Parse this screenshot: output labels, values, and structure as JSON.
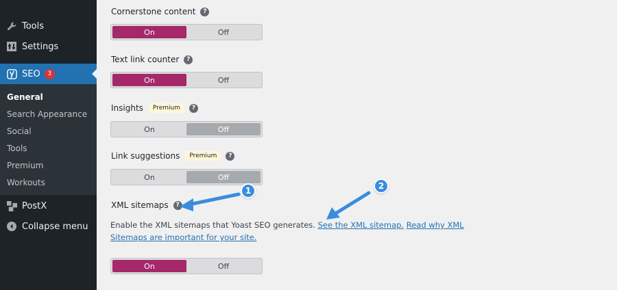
{
  "sidebar": {
    "items": [
      {
        "label": "Tools",
        "icon": "wrench-icon"
      },
      {
        "label": "Settings",
        "icon": "settings-icon"
      },
      {
        "label": "SEO",
        "icon": "yoast-icon",
        "badge": "3"
      },
      {
        "label": "PostX",
        "icon": "postx-icon"
      },
      {
        "label": "Collapse menu",
        "icon": "collapse-icon"
      }
    ],
    "submenu": [
      "General",
      "Search Appearance",
      "Social",
      "Tools",
      "Premium",
      "Workouts"
    ]
  },
  "settings": [
    {
      "label": "Cornerstone content",
      "on": "On",
      "off": "Off",
      "state": "on"
    },
    {
      "label": "Text link counter",
      "on": "On",
      "off": "Off",
      "state": "on"
    },
    {
      "label": "Insights",
      "premium": "Premium",
      "on": "On",
      "off": "Off",
      "state": "off"
    },
    {
      "label": "Link suggestions",
      "premium": "Premium",
      "on": "On",
      "off": "Off",
      "state": "off"
    },
    {
      "label": "XML sitemaps",
      "on": "On",
      "off": "Off",
      "state": "on"
    }
  ],
  "xml_description": {
    "text": "Enable the XML sitemaps that Yoast SEO generates.",
    "link1": "See the XML sitemap.",
    "link2": "Read why XML Sitemaps are important for your site."
  },
  "annotations": [
    "1",
    "2"
  ],
  "colors": {
    "sidebar": "#1d2327",
    "active": "#2271b1",
    "toggle_on": "#a4286a",
    "annotation": "#3a8dde"
  }
}
